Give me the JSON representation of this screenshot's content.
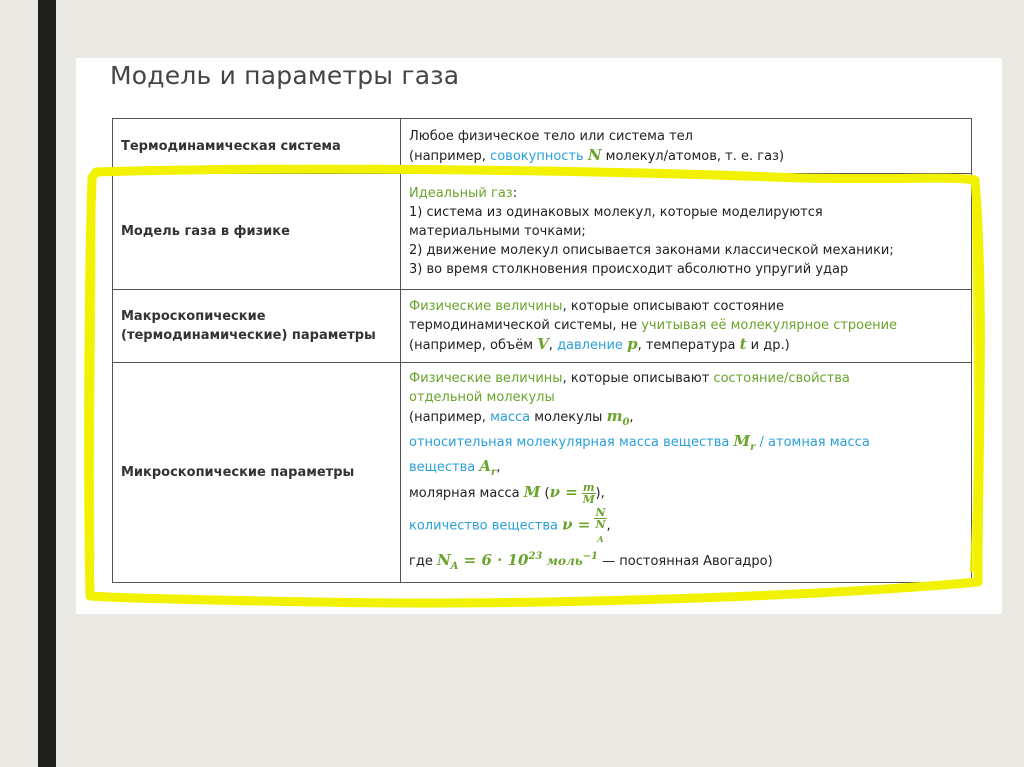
{
  "title": "Модель и параметры газа",
  "rows": [
    {
      "key": "Термодинамическая система",
      "lines": [
        {
          "a": "Любое ",
          "b": "физическое тело",
          "c": " или ",
          "d": "система тел"
        },
        {
          "a": "(например, ",
          "b": "совокупность",
          "sym": "N",
          "c": " молекул/атомов, т. е. газ)"
        }
      ]
    },
    {
      "key": "Модель газа в физике",
      "head": "Идеальный газ",
      "head_tail": ":",
      "items": [
        "1) система из одинаковых молекул, которые моделируются",
        "материальными точками;",
        "2) движение молекул описывается законами классической механики;",
        "3) во время столкновения происходит абсолютно упругий удар"
      ]
    },
    {
      "key": "Макроскопические (термодинамические) параметры",
      "l1a": "Физические величины",
      "l1b": ", которые описывают состояние",
      "l2a": "термодинамической системы, ",
      "l2b": "не",
      "l2c": " учитывая её молекулярное строение",
      "l3a": "(например, объём ",
      "l3v": "V",
      "l3b": ", ",
      "l3c": "давление",
      "l3p": "p",
      "l3d": ", температура ",
      "l3t": "t",
      "l3e": " и др.)"
    },
    {
      "key": "Микроскопические параметры",
      "l1a": "Физические величины",
      "l1b": ", которые описывают ",
      "l1c": "состояние/свойства",
      "l2": "отдельной молекулы",
      "l3a": "(например, ",
      "l3b": "масса",
      "l3c": " молекулы ",
      "l3m": "m",
      "l3sub": "0",
      "l3d": ",",
      "l4a": "относительная молекулярная масса вещества ",
      "l4m": "M",
      "l4sub": "r",
      "l4b": " / атомная масса",
      "l5a": "вещества ",
      "l5m": "A",
      "l5sub": "r",
      "l5b": ",",
      "l6a": "молярная масса ",
      "l6m": "M",
      "l6b": " (",
      "l6nu": "ν =",
      "l6num": "m",
      "l6den": "M",
      "l6c": "),",
      "l7a": "количество вещества ",
      "l7nu": "ν =",
      "l7num": "N",
      "l7den": "N",
      "l7densub": "A",
      "l7b": ",",
      "l8a": "где ",
      "l8n": "N",
      "l8sub": "A",
      "l8eq": " = 6 · 10",
      "l8exp": "23",
      "l8unit": " моль",
      "l8uexp": "−1",
      "l8b": " — постоянная Авогадро)"
    }
  ],
  "highlight_color": "#f2f200"
}
